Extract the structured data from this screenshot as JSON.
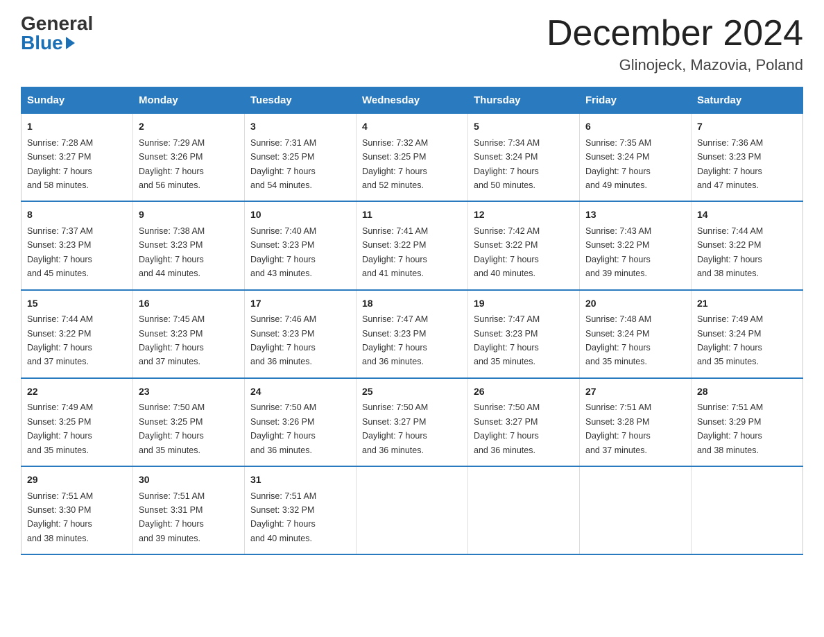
{
  "logo": {
    "general": "General",
    "blue": "Blue"
  },
  "title": "December 2024",
  "location": "Glinojeck, Mazovia, Poland",
  "days_of_week": [
    "Sunday",
    "Monday",
    "Tuesday",
    "Wednesday",
    "Thursday",
    "Friday",
    "Saturday"
  ],
  "weeks": [
    [
      {
        "day": "1",
        "info": "Sunrise: 7:28 AM\nSunset: 3:27 PM\nDaylight: 7 hours\nand 58 minutes."
      },
      {
        "day": "2",
        "info": "Sunrise: 7:29 AM\nSunset: 3:26 PM\nDaylight: 7 hours\nand 56 minutes."
      },
      {
        "day": "3",
        "info": "Sunrise: 7:31 AM\nSunset: 3:25 PM\nDaylight: 7 hours\nand 54 minutes."
      },
      {
        "day": "4",
        "info": "Sunrise: 7:32 AM\nSunset: 3:25 PM\nDaylight: 7 hours\nand 52 minutes."
      },
      {
        "day": "5",
        "info": "Sunrise: 7:34 AM\nSunset: 3:24 PM\nDaylight: 7 hours\nand 50 minutes."
      },
      {
        "day": "6",
        "info": "Sunrise: 7:35 AM\nSunset: 3:24 PM\nDaylight: 7 hours\nand 49 minutes."
      },
      {
        "day": "7",
        "info": "Sunrise: 7:36 AM\nSunset: 3:23 PM\nDaylight: 7 hours\nand 47 minutes."
      }
    ],
    [
      {
        "day": "8",
        "info": "Sunrise: 7:37 AM\nSunset: 3:23 PM\nDaylight: 7 hours\nand 45 minutes."
      },
      {
        "day": "9",
        "info": "Sunrise: 7:38 AM\nSunset: 3:23 PM\nDaylight: 7 hours\nand 44 minutes."
      },
      {
        "day": "10",
        "info": "Sunrise: 7:40 AM\nSunset: 3:23 PM\nDaylight: 7 hours\nand 43 minutes."
      },
      {
        "day": "11",
        "info": "Sunrise: 7:41 AM\nSunset: 3:22 PM\nDaylight: 7 hours\nand 41 minutes."
      },
      {
        "day": "12",
        "info": "Sunrise: 7:42 AM\nSunset: 3:22 PM\nDaylight: 7 hours\nand 40 minutes."
      },
      {
        "day": "13",
        "info": "Sunrise: 7:43 AM\nSunset: 3:22 PM\nDaylight: 7 hours\nand 39 minutes."
      },
      {
        "day": "14",
        "info": "Sunrise: 7:44 AM\nSunset: 3:22 PM\nDaylight: 7 hours\nand 38 minutes."
      }
    ],
    [
      {
        "day": "15",
        "info": "Sunrise: 7:44 AM\nSunset: 3:22 PM\nDaylight: 7 hours\nand 37 minutes."
      },
      {
        "day": "16",
        "info": "Sunrise: 7:45 AM\nSunset: 3:23 PM\nDaylight: 7 hours\nand 37 minutes."
      },
      {
        "day": "17",
        "info": "Sunrise: 7:46 AM\nSunset: 3:23 PM\nDaylight: 7 hours\nand 36 minutes."
      },
      {
        "day": "18",
        "info": "Sunrise: 7:47 AM\nSunset: 3:23 PM\nDaylight: 7 hours\nand 36 minutes."
      },
      {
        "day": "19",
        "info": "Sunrise: 7:47 AM\nSunset: 3:23 PM\nDaylight: 7 hours\nand 35 minutes."
      },
      {
        "day": "20",
        "info": "Sunrise: 7:48 AM\nSunset: 3:24 PM\nDaylight: 7 hours\nand 35 minutes."
      },
      {
        "day": "21",
        "info": "Sunrise: 7:49 AM\nSunset: 3:24 PM\nDaylight: 7 hours\nand 35 minutes."
      }
    ],
    [
      {
        "day": "22",
        "info": "Sunrise: 7:49 AM\nSunset: 3:25 PM\nDaylight: 7 hours\nand 35 minutes."
      },
      {
        "day": "23",
        "info": "Sunrise: 7:50 AM\nSunset: 3:25 PM\nDaylight: 7 hours\nand 35 minutes."
      },
      {
        "day": "24",
        "info": "Sunrise: 7:50 AM\nSunset: 3:26 PM\nDaylight: 7 hours\nand 36 minutes."
      },
      {
        "day": "25",
        "info": "Sunrise: 7:50 AM\nSunset: 3:27 PM\nDaylight: 7 hours\nand 36 minutes."
      },
      {
        "day": "26",
        "info": "Sunrise: 7:50 AM\nSunset: 3:27 PM\nDaylight: 7 hours\nand 36 minutes."
      },
      {
        "day": "27",
        "info": "Sunrise: 7:51 AM\nSunset: 3:28 PM\nDaylight: 7 hours\nand 37 minutes."
      },
      {
        "day": "28",
        "info": "Sunrise: 7:51 AM\nSunset: 3:29 PM\nDaylight: 7 hours\nand 38 minutes."
      }
    ],
    [
      {
        "day": "29",
        "info": "Sunrise: 7:51 AM\nSunset: 3:30 PM\nDaylight: 7 hours\nand 38 minutes."
      },
      {
        "day": "30",
        "info": "Sunrise: 7:51 AM\nSunset: 3:31 PM\nDaylight: 7 hours\nand 39 minutes."
      },
      {
        "day": "31",
        "info": "Sunrise: 7:51 AM\nSunset: 3:32 PM\nDaylight: 7 hours\nand 40 minutes."
      },
      null,
      null,
      null,
      null
    ]
  ]
}
